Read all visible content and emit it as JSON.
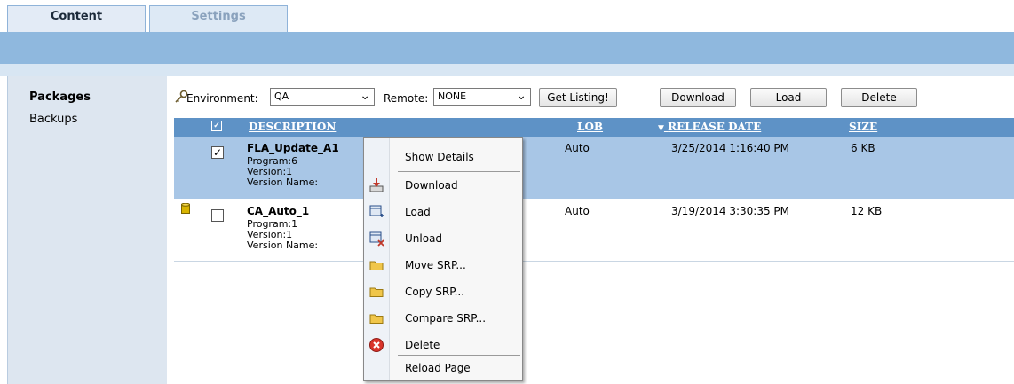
{
  "tabs": [
    {
      "label": "Content",
      "active": true
    },
    {
      "label": "Settings",
      "active": false
    }
  ],
  "sidebar": {
    "items": [
      {
        "label": "Packages",
        "active": true
      },
      {
        "label": "Backups",
        "active": false
      }
    ]
  },
  "toolbar": {
    "environment_label": "Environment:",
    "environment_value": "QA",
    "remote_label": "Remote:",
    "remote_value": "NONE",
    "get_listing_label": "Get Listing!",
    "download_label": "Download",
    "load_label": "Load",
    "delete_label": "Delete"
  },
  "table": {
    "columns": {
      "description": "DESCRIPTION",
      "lob": "LOB",
      "release_date": "RELEASE DATE",
      "size": "SIZE"
    },
    "sort_indicator": "▼",
    "header_checkbox_checked": true,
    "rows": [
      {
        "title": "FLA_Update_A1",
        "program": "Program:6",
        "version": "Version:1",
        "version_name": "Version Name:",
        "lob": "Auto",
        "release_date": "3/25/2014 1:16:40 PM",
        "size": "6 KB",
        "checked": true,
        "selected": true,
        "installed_icon": false
      },
      {
        "title": "CA_Auto_1",
        "program": "Program:1",
        "version": "Version:1",
        "version_name": "Version Name:",
        "lob": "Auto",
        "release_date": "3/19/2014 3:30:35 PM",
        "size": "12 KB",
        "checked": false,
        "selected": false,
        "installed_icon": true
      }
    ]
  },
  "context_menu": {
    "items": [
      {
        "label": "Show Details",
        "icon": "none"
      },
      {
        "label": "Download",
        "icon": "download-icon"
      },
      {
        "label": "Load",
        "icon": "load-icon"
      },
      {
        "label": "Unload",
        "icon": "unload-icon"
      },
      {
        "label": "Move SRP...",
        "icon": "folder-icon"
      },
      {
        "label": "Copy SRP...",
        "icon": "folder-icon"
      },
      {
        "label": "Compare SRP...",
        "icon": "folder-icon"
      },
      {
        "label": "Delete",
        "icon": "delete-icon"
      },
      {
        "label": "Reload Page",
        "icon": "none"
      }
    ]
  },
  "colors": {
    "header_blue": "#5e92c6",
    "selected_row": "#a8c6e6",
    "banner": "#8fb8de"
  }
}
